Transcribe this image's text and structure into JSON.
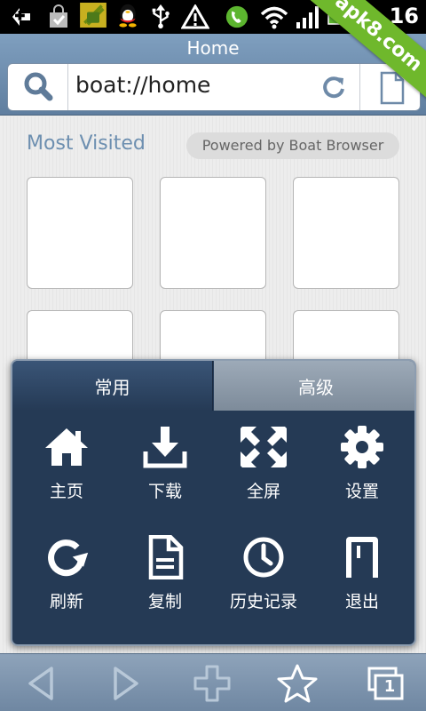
{
  "status_bar": {
    "time": "16",
    "watermark": "apk8.com",
    "icons": [
      "add-icon",
      "shopping-bag-icon",
      "android-icon",
      "qq-penguin-icon",
      "usb-icon",
      "warning-icon",
      "phone-icon",
      "wifi-icon",
      "signal-icon",
      "battery-icon"
    ]
  },
  "header": {
    "title": "Home",
    "url": "boat://home"
  },
  "content": {
    "section_title": "Most Visited",
    "powered_by": "Powered by Boat Browser"
  },
  "menu": {
    "tabs": [
      {
        "label": "常用",
        "active": true
      },
      {
        "label": "高级",
        "active": false
      }
    ],
    "items": [
      {
        "label": "主页",
        "icon": "home-icon"
      },
      {
        "label": "下载",
        "icon": "download-icon"
      },
      {
        "label": "全屏",
        "icon": "fullscreen-icon"
      },
      {
        "label": "设置",
        "icon": "settings-gear-icon"
      },
      {
        "label": "刷新",
        "icon": "refresh-icon"
      },
      {
        "label": "复制",
        "icon": "copy-document-icon"
      },
      {
        "label": "历史记录",
        "icon": "history-clock-icon"
      },
      {
        "label": "退出",
        "icon": "exit-icon"
      }
    ]
  },
  "bottom_bar": {
    "tab_count": "1",
    "icons": [
      "back-icon",
      "forward-icon",
      "add-tab-icon",
      "bookmark-star-icon",
      "tabs-icon"
    ]
  },
  "colors": {
    "menu_bg": "#253a55",
    "title_bar": "#6f8fb0",
    "section_title": "#6d8fb0",
    "watermark": "#6fb82c"
  }
}
